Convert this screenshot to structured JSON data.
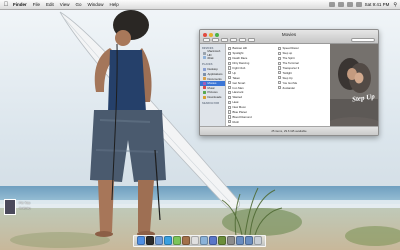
{
  "menubar": {
    "apple_icon": "apple-logo-icon",
    "items": [
      "Finder",
      "File",
      "Edit",
      "View",
      "Go",
      "Window",
      "Help"
    ],
    "status_icons": [
      "bluetooth-icon",
      "wifi-icon",
      "volume-icon",
      "battery-icon"
    ],
    "clock": "Sat 9:41 PM"
  },
  "window": {
    "title": "Movies",
    "sidebar": {
      "devices_header": "DEVICES",
      "devices": [
        "Macintosh HD",
        "iDisk"
      ],
      "places_header": "PLACES",
      "places": [
        {
          "label": "Desktop",
          "color": "#8a9fd1"
        },
        {
          "label": "Applications",
          "color": "#7b8fa8"
        },
        {
          "label": "Documents",
          "color": "#d9a24b"
        },
        {
          "label": "Movies",
          "color": "#a35cb8"
        },
        {
          "label": "Music",
          "color": "#d84a4a"
        },
        {
          "label": "Pictures",
          "color": "#58a84f"
        },
        {
          "label": "Downloads",
          "color": "#d8a030"
        }
      ],
      "selected": "Movies",
      "search_header": "SEARCH FOR"
    },
    "files_col1": [
      "Batman HD",
      "Spotlight",
      "Death Race",
      "Dirty Dancing",
      "Fight Club",
      "Up",
      "Taken",
      "Get Smart",
      "Iron Man",
      "Hancock",
      "Wanted",
      "Heat",
      "New Moon",
      "Blue Planet",
      "Blood Diamond",
      "Rush",
      "Nightmare HD"
    ],
    "files_col2": [
      "Speed Racer",
      "Step up",
      "The Spirit",
      "The Terminal",
      "Transporter 3",
      "Twilight",
      "Step Up",
      "You Got Me",
      "Zoolander"
    ],
    "preview_title": "Step Up",
    "status": "25 items, 29.6 GB available"
  },
  "nowplaying": {
    "title": "Fix You",
    "artist": "Coldplay"
  },
  "dock": {
    "icons": [
      {
        "name": "finder-icon",
        "color": "#4f8fe3"
      },
      {
        "name": "dashboard-icon",
        "color": "#2b2b2b"
      },
      {
        "name": "mail-icon",
        "color": "#6f9bd6"
      },
      {
        "name": "safari-icon",
        "color": "#3aa0e0"
      },
      {
        "name": "ichat-icon",
        "color": "#7cc55a"
      },
      {
        "name": "address-book-icon",
        "color": "#a3714b"
      },
      {
        "name": "ical-icon",
        "color": "#e0e0e0"
      },
      {
        "name": "preview-icon",
        "color": "#8bb2d8"
      },
      {
        "name": "itunes-icon",
        "color": "#5a76c8"
      },
      {
        "name": "iphoto-icon",
        "color": "#6b8e3a"
      },
      {
        "name": "system-preferences-icon",
        "color": "#8c8c8c"
      },
      {
        "name": "applications-folder-icon",
        "color": "#6a8dbf"
      },
      {
        "name": "downloads-folder-icon",
        "color": "#6a8dbf"
      },
      {
        "name": "trash-icon",
        "color": "#c9cfd6"
      }
    ]
  }
}
